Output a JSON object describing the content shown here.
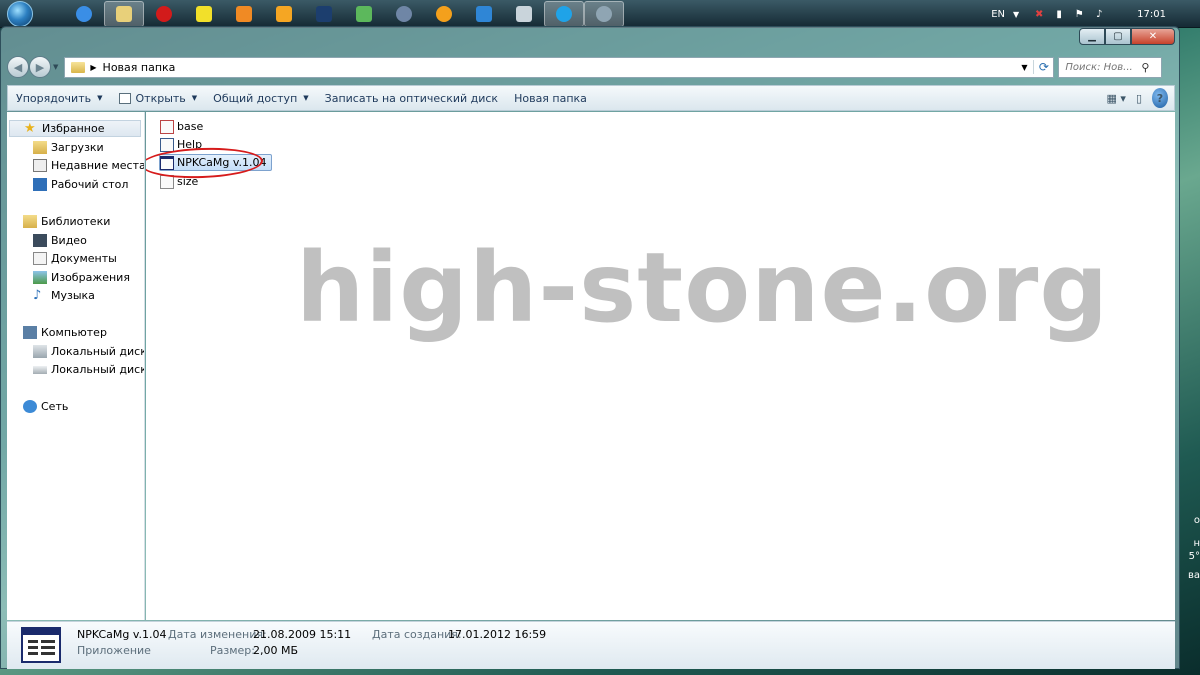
{
  "taskbar": {
    "icons": [
      "windows-orb",
      "ie",
      "explorer",
      "opera",
      "app-yellow",
      "aimp",
      "player",
      "photoshop",
      "app-green",
      "globe",
      "app-orange",
      "app-blue",
      "calculator",
      "skype",
      "app-gray"
    ],
    "language": "EN",
    "clock": "17:01"
  },
  "window": {
    "address": {
      "path": "Новая папка",
      "search_placeholder": "Поиск: Нов..."
    },
    "toolbar": {
      "organize": "Упорядочить",
      "open": "Открыть",
      "share": "Общий доступ",
      "burn": "Записать на оптический диск",
      "new_folder": "Новая папка"
    },
    "nav": {
      "favorites": "Избранное",
      "downloads": "Загрузки",
      "recent": "Недавние места",
      "desktop": "Рабочий стол",
      "libraries": "Библиотеки",
      "video": "Видео",
      "documents": "Документы",
      "images": "Изображения",
      "music": "Музыка",
      "computer": "Компьютер",
      "disk_c": "Локальный диск (C",
      "disk_d": "Локальный диск (D",
      "network": "Сеть"
    },
    "files": [
      {
        "name": "base"
      },
      {
        "name": "Help"
      },
      {
        "name": "NPKCaMg v.1.04"
      },
      {
        "name": "size"
      }
    ],
    "watermark": "high-stone.org",
    "details": {
      "name": "NPKCaMg v.1.04",
      "type": "Приложение",
      "modified_label": "Дата изменения:",
      "modified_value": "21.08.2009 15:11",
      "size_label": "Размер:",
      "size_value": "2,00 МБ",
      "created_label": "Дата создания:",
      "created_value": "17.01.2012 16:59"
    }
  },
  "edge": {
    "chars": [
      "о",
      "н",
      "5°",
      "ва"
    ]
  },
  "colors": {
    "accent": "#1e395b",
    "selection": "#c5def8",
    "red_mark": "#d61b1b"
  }
}
